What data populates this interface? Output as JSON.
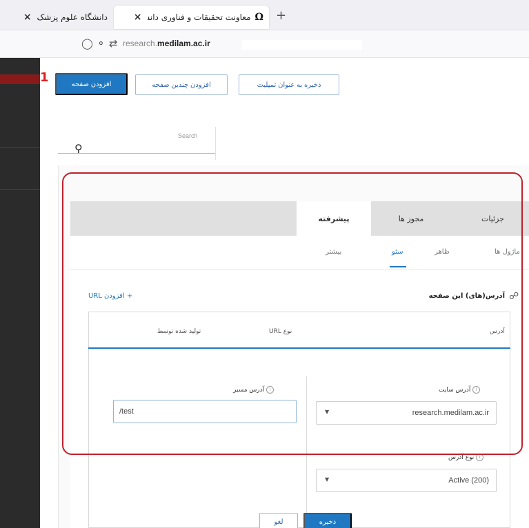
{
  "browser": {
    "tabs": [
      {
        "title": "دانشگاه علوم پزشک",
        "close": "×"
      },
      {
        "title": "معاونت تحقیقات و فناوری دانشگ",
        "close": "×",
        "favicon": "Ω"
      }
    ],
    "new_tab": "+",
    "url_plain": "research.",
    "url_bold": "medilam.ac.ir"
  },
  "step_marker": "1",
  "toolbar": {
    "add_page": "افزودن صفحه",
    "add_multiple_pages": "افزودن چندین صفحه",
    "save_as_template": "ذخیره به عنوان تمپلیت"
  },
  "search": {
    "placeholder": "Search"
  },
  "tabs": {
    "details": "جزئیات",
    "permissions": "مجوز ها",
    "advanced": "پیشرفته"
  },
  "subtabs": {
    "modules": "ماژول ها",
    "appearance": "ظاهر",
    "seo": "سئو",
    "more": "بیشتر"
  },
  "addresses": {
    "heading": "آدرس(های) این صفحه",
    "add_url": "+ افزودن URL",
    "columns": {
      "address": "آدرس",
      "url_type": "نوع URL",
      "generated_by": "تولید شده توسط"
    }
  },
  "form": {
    "site_address_label": "آدرس سایت",
    "site_address_value": "research.medilam.ac.ir",
    "path_label": "آدرس مسیر",
    "path_value": "/test",
    "address_type_label": "نوع آدرس",
    "address_type_value": "Active (200)",
    "save": "ذخیره",
    "cancel": "لغو"
  },
  "colors": {
    "accent": "#1f78c1",
    "highlight": "#c0202a",
    "sidebar": "#2b2b2b"
  }
}
